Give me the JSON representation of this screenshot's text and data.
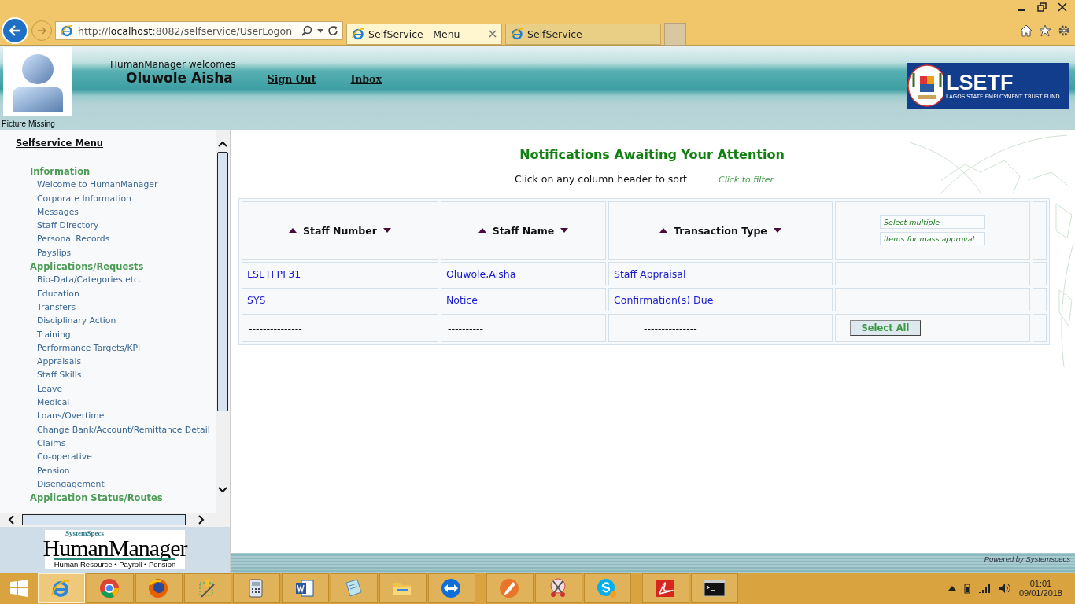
{
  "browser": {
    "address": {
      "scheme": "http://",
      "host": "localhost",
      "rest": ":8082/selfservice/UserLogon"
    },
    "tabs": [
      {
        "label": "SelfService - Menu",
        "selected": true
      },
      {
        "label": "SelfService",
        "selected": false
      }
    ]
  },
  "header": {
    "welcome": "HumanManager welcomes",
    "user": "Oluwole Aisha",
    "links": [
      "Sign Out",
      "Inbox"
    ],
    "picture_caption": "Picture Missing",
    "logo": {
      "title": "LSETF",
      "subtitle": "LAGOS STATE EMPLOYMENT TRUST FUND"
    }
  },
  "sidebar": {
    "title": "Selfservice Menu",
    "groups": [
      {
        "label": "Information",
        "items": [
          "Welcome to HumanManager",
          "Corporate Information",
          "Messages",
          "Staff Directory",
          "Personal Records",
          "Payslips"
        ]
      },
      {
        "label": "Applications/Requests",
        "items": [
          "Bio-Data/Categories etc.",
          "Education",
          "Transfers",
          "Disciplinary Action",
          "Training",
          "Performance Targets/KPI",
          "Appraisals",
          "Staff Skills",
          "Leave",
          "Medical",
          "Loans/Overtime",
          "Change Bank/Account/Remittance Detail",
          "Claims",
          "Co-operative",
          "Pension",
          "Disengagement"
        ]
      },
      {
        "label": "Application Status/Routes"
      }
    ],
    "logo": {
      "brand": "SystemSpecs",
      "name": "HumanManager",
      "tagline": "Human Resource • Payroll • Pension"
    }
  },
  "main": {
    "title": "Notifications Awaiting Your Attention",
    "sort_hint": "Click on any column header to sort",
    "filter_link": "Click to filter",
    "table": {
      "columns": [
        "Staff Number",
        "Staff Name",
        "Transaction Type"
      ],
      "mass_approval_hint": [
        "Select multiple",
        "items for mass approval"
      ],
      "rows": [
        [
          "LSETFPF31",
          "Oluwole,Aisha",
          "Staff Appraisal"
        ],
        [
          "SYS",
          "Notice",
          "Confirmation(s) Due"
        ]
      ],
      "footer_row": [
        "---------------",
        "----------",
        "---------------"
      ],
      "select_all": "Select All"
    },
    "powered_by": "Powered by Systemspecs"
  },
  "taskbar": {
    "apps": [
      {
        "kind": "ie",
        "active": true
      },
      {
        "kind": "chrome",
        "active": false
      },
      {
        "kind": "firefox",
        "active": false
      },
      {
        "kind": "tools",
        "active": false
      },
      {
        "kind": "calculator",
        "active": false
      },
      {
        "kind": "word",
        "active": false
      },
      {
        "kind": "notepad",
        "active": false
      },
      {
        "kind": "folder",
        "active": false
      },
      {
        "kind": "remote",
        "active": false
      },
      {
        "kind": "pen",
        "active": false
      },
      {
        "kind": "snip",
        "active": false
      },
      {
        "kind": "skype",
        "active": false
      },
      {
        "kind": "pdf",
        "active": false
      },
      {
        "kind": "terminal",
        "active": false
      }
    ],
    "time": "01:01",
    "date": "09/01/2018"
  }
}
